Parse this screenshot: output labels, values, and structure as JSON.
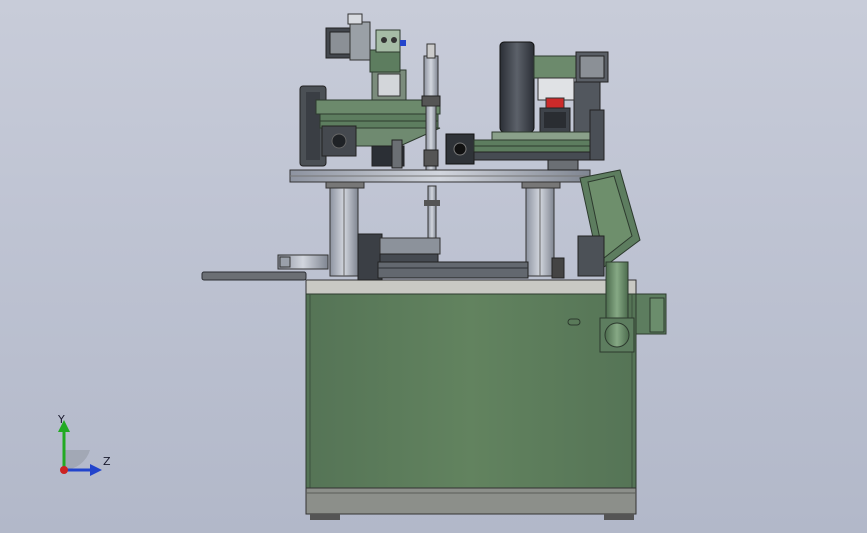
{
  "viewport": {
    "background_top": "#c8ccd9",
    "background_bottom": "#b2b8c9"
  },
  "model": {
    "cabinet_color": "#5d7d5f",
    "frame_color": "#3c4a3d",
    "accent_red": "#cc2a2a",
    "accent_blue": "#2244cc"
  },
  "triad": {
    "y_label": "Y",
    "z_label": "Z",
    "y_color": "#22aa22",
    "z_color": "#2244cc",
    "origin_color": "#cc2222"
  }
}
